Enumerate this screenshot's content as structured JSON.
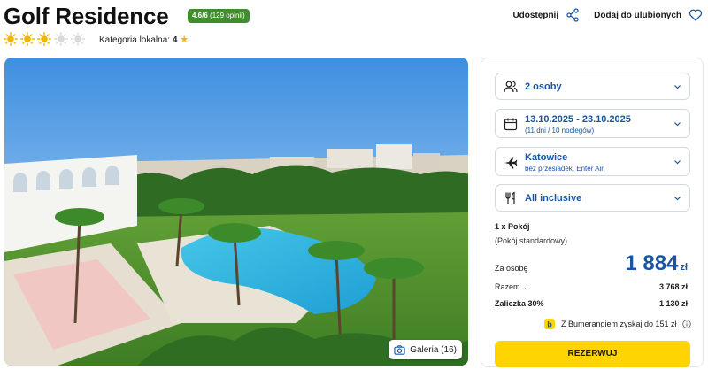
{
  "header": {
    "title": "Golf Residence",
    "rating_score": "4.6/6",
    "rating_count": "(129 opinii)",
    "suns_total": 5,
    "suns_filled": 3,
    "category_label": "Kategoria lokalna:",
    "category_value": "4",
    "share_label": "Udostępnij",
    "favorite_label": "Dodaj do ulubionych"
  },
  "photo": {
    "gallery_label": "Galeria (16)"
  },
  "booking": {
    "persons": "2 osoby",
    "dates": "13.10.2025 - 23.10.2025",
    "dates_sub": "(11 dni / 10 noclegów)",
    "departure": "Katowice",
    "departure_sub": "bez przesiadek, Enter Air",
    "board": "All inclusive",
    "room_count": "1 x Pokój",
    "room_type": "(Pokój standardowy)",
    "per_person_label": "Za osobę",
    "price": "1 884",
    "currency": "zł",
    "total_label": "Razem",
    "total_value": "3 768 zł",
    "deposit_label": "Zaliczka 30%",
    "deposit_value": "1 130 zł",
    "bumerang_text": "Z Bumerangiem zyskaj do 151 zł",
    "reserve_label": "REZERWUJ"
  },
  "colors": {
    "accent_blue": "#1a55a5",
    "rating_green": "#3e8e2b",
    "reserve_yellow": "#ffd400",
    "sun_filled": "#f5b400",
    "sun_empty": "#d9d9d9"
  }
}
